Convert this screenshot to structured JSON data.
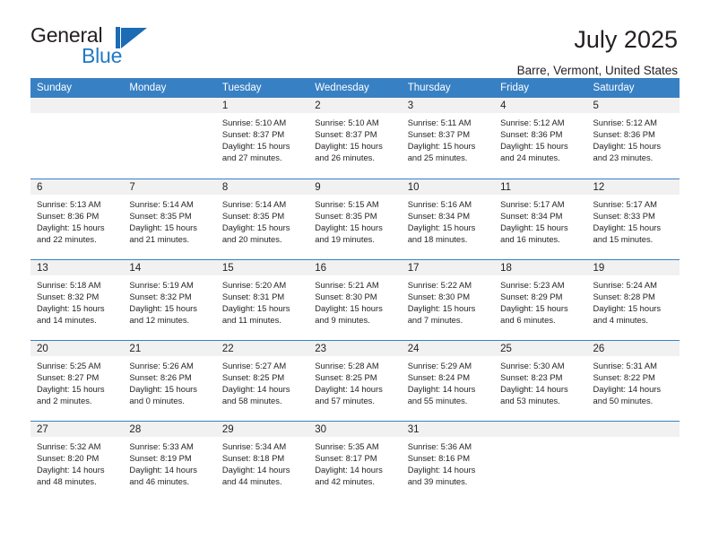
{
  "brand": {
    "name_part1": "General",
    "name_part2": "Blue",
    "accent_color": "#1b6cb5"
  },
  "header": {
    "title": "July 2025",
    "location": "Barre, Vermont, United States"
  },
  "calendar": {
    "header_bg": "#3880c4",
    "weekdays": [
      "Sunday",
      "Monday",
      "Tuesday",
      "Wednesday",
      "Thursday",
      "Friday",
      "Saturday"
    ],
    "weeks": [
      [
        {
          "day": "",
          "sunrise": "",
          "sunset": "",
          "daylight": ""
        },
        {
          "day": "",
          "sunrise": "",
          "sunset": "",
          "daylight": ""
        },
        {
          "day": "1",
          "sunrise": "Sunrise: 5:10 AM",
          "sunset": "Sunset: 8:37 PM",
          "daylight": "Daylight: 15 hours and 27 minutes."
        },
        {
          "day": "2",
          "sunrise": "Sunrise: 5:10 AM",
          "sunset": "Sunset: 8:37 PM",
          "daylight": "Daylight: 15 hours and 26 minutes."
        },
        {
          "day": "3",
          "sunrise": "Sunrise: 5:11 AM",
          "sunset": "Sunset: 8:37 PM",
          "daylight": "Daylight: 15 hours and 25 minutes."
        },
        {
          "day": "4",
          "sunrise": "Sunrise: 5:12 AM",
          "sunset": "Sunset: 8:36 PM",
          "daylight": "Daylight: 15 hours and 24 minutes."
        },
        {
          "day": "5",
          "sunrise": "Sunrise: 5:12 AM",
          "sunset": "Sunset: 8:36 PM",
          "daylight": "Daylight: 15 hours and 23 minutes."
        }
      ],
      [
        {
          "day": "6",
          "sunrise": "Sunrise: 5:13 AM",
          "sunset": "Sunset: 8:36 PM",
          "daylight": "Daylight: 15 hours and 22 minutes."
        },
        {
          "day": "7",
          "sunrise": "Sunrise: 5:14 AM",
          "sunset": "Sunset: 8:35 PM",
          "daylight": "Daylight: 15 hours and 21 minutes."
        },
        {
          "day": "8",
          "sunrise": "Sunrise: 5:14 AM",
          "sunset": "Sunset: 8:35 PM",
          "daylight": "Daylight: 15 hours and 20 minutes."
        },
        {
          "day": "9",
          "sunrise": "Sunrise: 5:15 AM",
          "sunset": "Sunset: 8:35 PM",
          "daylight": "Daylight: 15 hours and 19 minutes."
        },
        {
          "day": "10",
          "sunrise": "Sunrise: 5:16 AM",
          "sunset": "Sunset: 8:34 PM",
          "daylight": "Daylight: 15 hours and 18 minutes."
        },
        {
          "day": "11",
          "sunrise": "Sunrise: 5:17 AM",
          "sunset": "Sunset: 8:34 PM",
          "daylight": "Daylight: 15 hours and 16 minutes."
        },
        {
          "day": "12",
          "sunrise": "Sunrise: 5:17 AM",
          "sunset": "Sunset: 8:33 PM",
          "daylight": "Daylight: 15 hours and 15 minutes."
        }
      ],
      [
        {
          "day": "13",
          "sunrise": "Sunrise: 5:18 AM",
          "sunset": "Sunset: 8:32 PM",
          "daylight": "Daylight: 15 hours and 14 minutes."
        },
        {
          "day": "14",
          "sunrise": "Sunrise: 5:19 AM",
          "sunset": "Sunset: 8:32 PM",
          "daylight": "Daylight: 15 hours and 12 minutes."
        },
        {
          "day": "15",
          "sunrise": "Sunrise: 5:20 AM",
          "sunset": "Sunset: 8:31 PM",
          "daylight": "Daylight: 15 hours and 11 minutes."
        },
        {
          "day": "16",
          "sunrise": "Sunrise: 5:21 AM",
          "sunset": "Sunset: 8:30 PM",
          "daylight": "Daylight: 15 hours and 9 minutes."
        },
        {
          "day": "17",
          "sunrise": "Sunrise: 5:22 AM",
          "sunset": "Sunset: 8:30 PM",
          "daylight": "Daylight: 15 hours and 7 minutes."
        },
        {
          "day": "18",
          "sunrise": "Sunrise: 5:23 AM",
          "sunset": "Sunset: 8:29 PM",
          "daylight": "Daylight: 15 hours and 6 minutes."
        },
        {
          "day": "19",
          "sunrise": "Sunrise: 5:24 AM",
          "sunset": "Sunset: 8:28 PM",
          "daylight": "Daylight: 15 hours and 4 minutes."
        }
      ],
      [
        {
          "day": "20",
          "sunrise": "Sunrise: 5:25 AM",
          "sunset": "Sunset: 8:27 PM",
          "daylight": "Daylight: 15 hours and 2 minutes."
        },
        {
          "day": "21",
          "sunrise": "Sunrise: 5:26 AM",
          "sunset": "Sunset: 8:26 PM",
          "daylight": "Daylight: 15 hours and 0 minutes."
        },
        {
          "day": "22",
          "sunrise": "Sunrise: 5:27 AM",
          "sunset": "Sunset: 8:25 PM",
          "daylight": "Daylight: 14 hours and 58 minutes."
        },
        {
          "day": "23",
          "sunrise": "Sunrise: 5:28 AM",
          "sunset": "Sunset: 8:25 PM",
          "daylight": "Daylight: 14 hours and 57 minutes."
        },
        {
          "day": "24",
          "sunrise": "Sunrise: 5:29 AM",
          "sunset": "Sunset: 8:24 PM",
          "daylight": "Daylight: 14 hours and 55 minutes."
        },
        {
          "day": "25",
          "sunrise": "Sunrise: 5:30 AM",
          "sunset": "Sunset: 8:23 PM",
          "daylight": "Daylight: 14 hours and 53 minutes."
        },
        {
          "day": "26",
          "sunrise": "Sunrise: 5:31 AM",
          "sunset": "Sunset: 8:22 PM",
          "daylight": "Daylight: 14 hours and 50 minutes."
        }
      ],
      [
        {
          "day": "27",
          "sunrise": "Sunrise: 5:32 AM",
          "sunset": "Sunset: 8:20 PM",
          "daylight": "Daylight: 14 hours and 48 minutes."
        },
        {
          "day": "28",
          "sunrise": "Sunrise: 5:33 AM",
          "sunset": "Sunset: 8:19 PM",
          "daylight": "Daylight: 14 hours and 46 minutes."
        },
        {
          "day": "29",
          "sunrise": "Sunrise: 5:34 AM",
          "sunset": "Sunset: 8:18 PM",
          "daylight": "Daylight: 14 hours and 44 minutes."
        },
        {
          "day": "30",
          "sunrise": "Sunrise: 5:35 AM",
          "sunset": "Sunset: 8:17 PM",
          "daylight": "Daylight: 14 hours and 42 minutes."
        },
        {
          "day": "31",
          "sunrise": "Sunrise: 5:36 AM",
          "sunset": "Sunset: 8:16 PM",
          "daylight": "Daylight: 14 hours and 39 minutes."
        },
        {
          "day": "",
          "sunrise": "",
          "sunset": "",
          "daylight": ""
        },
        {
          "day": "",
          "sunrise": "",
          "sunset": "",
          "daylight": ""
        }
      ]
    ]
  }
}
